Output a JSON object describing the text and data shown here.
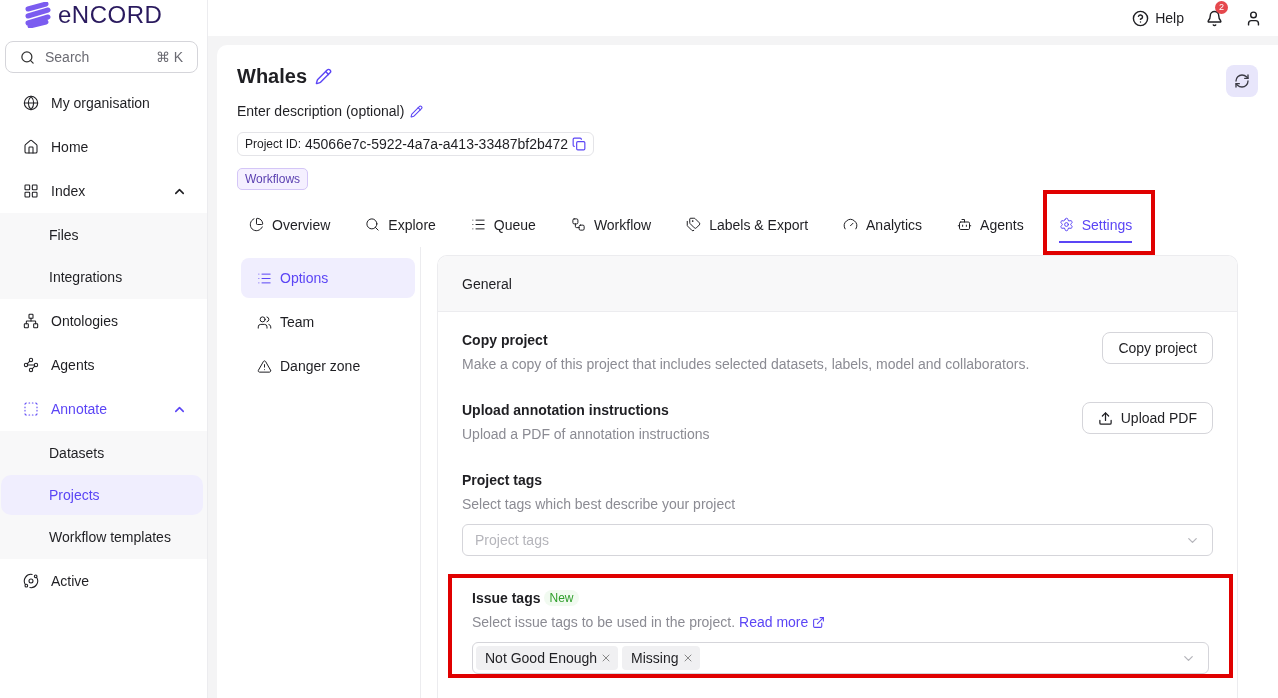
{
  "brand": {
    "name": "eNCORD"
  },
  "search": {
    "placeholder": "Search",
    "shortcut": "⌘ K"
  },
  "sidebar": {
    "items": [
      {
        "label": "My organisation",
        "selected": false
      },
      {
        "label": "Home",
        "selected": false
      },
      {
        "label": "Index",
        "selected": false,
        "expanded": true,
        "children": [
          {
            "label": "Files",
            "selected": false
          },
          {
            "label": "Integrations",
            "selected": false
          }
        ]
      },
      {
        "label": "Ontologies",
        "selected": false
      },
      {
        "label": "Agents",
        "selected": false
      },
      {
        "label": "Annotate",
        "selected": true,
        "expanded": true,
        "children": [
          {
            "label": "Datasets",
            "selected": false
          },
          {
            "label": "Projects",
            "selected": true
          },
          {
            "label": "Workflow templates",
            "selected": false
          }
        ]
      },
      {
        "label": "Active",
        "selected": false
      }
    ]
  },
  "header": {
    "help": "Help",
    "notifications": "2"
  },
  "project": {
    "title": "Whales",
    "description": "Enter description (optional)",
    "id_label": "Project ID:",
    "id": "45066e7c-5922-4a7a-a413-33487bf2b472",
    "tag": "Workflows"
  },
  "tabs": [
    {
      "label": "Overview",
      "selected": false,
      "highlighted": false
    },
    {
      "label": "Explore",
      "selected": false,
      "highlighted": false
    },
    {
      "label": "Queue",
      "selected": false,
      "highlighted": false
    },
    {
      "label": "Workflow",
      "selected": false,
      "highlighted": false
    },
    {
      "label": "Labels & Export",
      "selected": false,
      "highlighted": false
    },
    {
      "label": "Analytics",
      "selected": false,
      "highlighted": false
    },
    {
      "label": "Agents",
      "selected": false,
      "highlighted": false
    },
    {
      "label": "Settings",
      "selected": true,
      "highlighted": true
    }
  ],
  "settings_nav": [
    {
      "label": "Options",
      "selected": true
    },
    {
      "label": "Team",
      "selected": false
    },
    {
      "label": "Danger zone",
      "selected": false
    }
  ],
  "panel": {
    "title": "General",
    "sections": [
      {
        "kind": "button",
        "title": "Copy project",
        "description": "Make a copy of this project that includes selected datasets, labels, model and collaborators.",
        "button": "Copy project",
        "highlighted": false
      },
      {
        "kind": "upload",
        "title": "Upload annotation instructions",
        "description": "Upload a PDF of annotation instructions",
        "button": "Upload PDF",
        "highlighted": false
      },
      {
        "kind": "select",
        "title": "Project tags",
        "description": "Select tags which best describe your project",
        "placeholder": "Project tags",
        "highlighted": false
      },
      {
        "kind": "tags",
        "title": "Issue tags",
        "badge": "New",
        "description": "Select issue tags to be used in the project.",
        "link": "Read more",
        "tags": [
          "Not Good Enough",
          "Missing"
        ],
        "highlighted": true
      }
    ]
  }
}
